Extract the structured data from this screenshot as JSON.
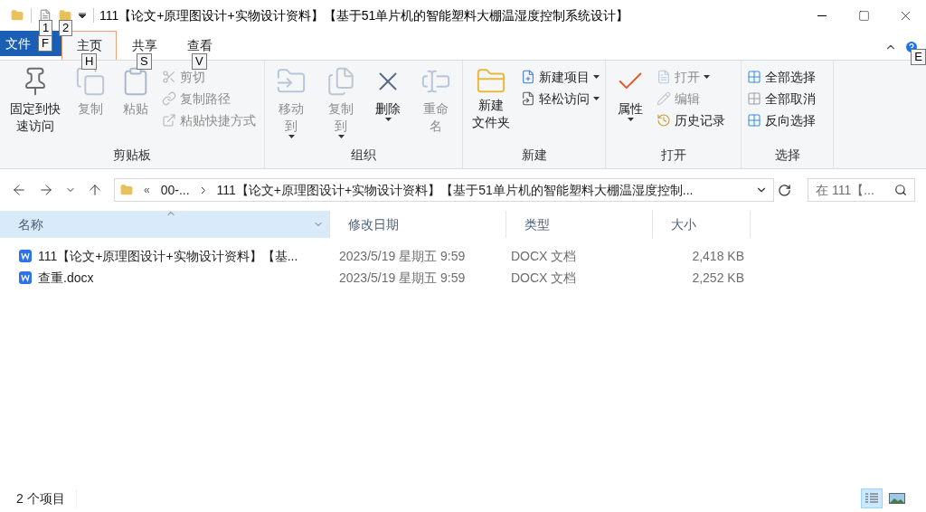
{
  "window": {
    "title": "111【论文+原理图设计+实物设计资料】【基于51单片机的智能塑料大棚温湿度控制系统设计】"
  },
  "quick_access_keytips": [
    "1",
    "2"
  ],
  "tabs": [
    {
      "label": "文件",
      "kind": "file",
      "keytip": "F",
      "selected": false
    },
    {
      "label": "主页",
      "kind": "tab",
      "keytip": "H",
      "selected": true
    },
    {
      "label": "共享",
      "kind": "tab",
      "keytip": "S",
      "selected": false
    },
    {
      "label": "查看",
      "kind": "tab",
      "keytip": "V",
      "selected": false
    }
  ],
  "help_keytip": "E",
  "ribbon": {
    "groups": [
      {
        "label": "剪贴板",
        "items": [
          {
            "kind": "large",
            "label": "固定到快速访问",
            "disabled": false,
            "dropdown": false
          },
          {
            "kind": "large",
            "label": "复制",
            "disabled": true,
            "dropdown": false
          },
          {
            "kind": "large",
            "label": "粘贴",
            "disabled": true,
            "dropdown": false
          },
          {
            "kind": "small",
            "label": "剪切",
            "disabled": true,
            "dropdown": false
          },
          {
            "kind": "small",
            "label": "复制路径",
            "disabled": true,
            "dropdown": false
          },
          {
            "kind": "small",
            "label": "粘贴快捷方式",
            "disabled": true,
            "dropdown": false
          }
        ]
      },
      {
        "label": "组织",
        "items": [
          {
            "kind": "large",
            "label": "移动到",
            "disabled": true,
            "dropdown": true
          },
          {
            "kind": "large",
            "label": "复制到",
            "disabled": true,
            "dropdown": true
          },
          {
            "kind": "large",
            "label": "删除",
            "disabled": false,
            "dropdown": true
          },
          {
            "kind": "large",
            "label": "重命名",
            "disabled": true,
            "dropdown": false
          }
        ]
      },
      {
        "label": "新建",
        "items": [
          {
            "kind": "large",
            "label": [
              "新建",
              "文件夹"
            ],
            "disabled": false,
            "dropdown": false
          },
          {
            "kind": "small",
            "label": "新建项目",
            "disabled": false,
            "dropdown": true
          },
          {
            "kind": "small",
            "label": "轻松访问",
            "disabled": false,
            "dropdown": true
          }
        ]
      },
      {
        "label": "打开",
        "items": [
          {
            "kind": "large",
            "label": "属性",
            "disabled": false,
            "dropdown": true
          },
          {
            "kind": "small",
            "label": "打开",
            "disabled": true,
            "dropdown": true
          },
          {
            "kind": "small",
            "label": "编辑",
            "disabled": true,
            "dropdown": false
          },
          {
            "kind": "small",
            "label": "历史记录",
            "disabled": false,
            "dropdown": false
          }
        ]
      },
      {
        "label": "选择",
        "items": [
          {
            "kind": "small",
            "label": "全部选择",
            "disabled": false,
            "dropdown": false
          },
          {
            "kind": "small",
            "label": "全部取消",
            "disabled": false,
            "dropdown": false
          },
          {
            "kind": "small",
            "label": "反向选择",
            "disabled": false,
            "dropdown": false
          }
        ]
      }
    ]
  },
  "address_bar": {
    "overflow": "«",
    "crumbs": [
      "00-...",
      "111【论文+原理图设计+实物设计资料】【基于51单片机的智能塑料大棚温湿度控制..."
    ]
  },
  "search": {
    "placeholder": "在 111【..."
  },
  "table": {
    "columns": [
      "名称",
      "修改日期",
      "类型",
      "大小"
    ],
    "rows": [
      {
        "name": "111【论文+原理图设计+实物设计资料】【基...",
        "modified": "2023/5/19 星期五 9:59",
        "type": "DOCX 文档",
        "size": "2,418 KB",
        "selected": false
      },
      {
        "name": "查重.docx",
        "modified": "2023/5/19 星期五 9:59",
        "type": "DOCX 文档",
        "size": "2,252 KB",
        "selected": false
      }
    ]
  },
  "status_bar": {
    "count": "2 个项目",
    "views": [
      {
        "kind": "details",
        "selected": true
      },
      {
        "kind": "tiles",
        "selected": false
      }
    ]
  }
}
